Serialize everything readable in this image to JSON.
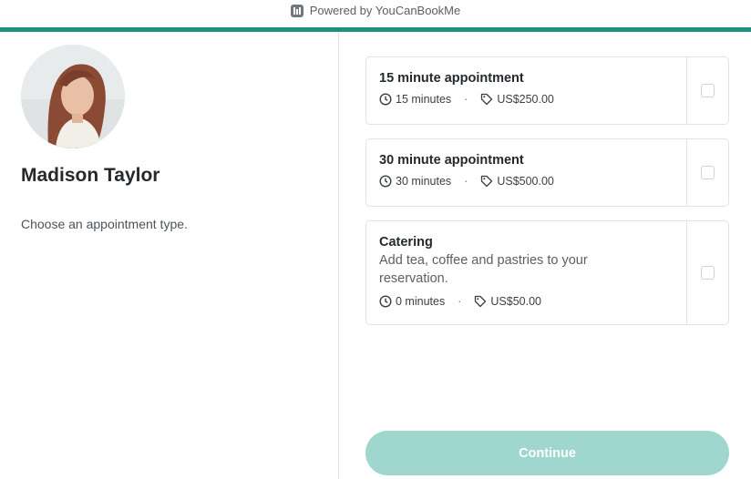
{
  "header": {
    "powered_by": "Powered by YouCanBookMe",
    "logo_icon": "calendar-logo-icon",
    "accent_color": "#1f8f7f"
  },
  "host": {
    "name": "Madison Taylor",
    "avatar_icon": "profile-photo",
    "instruction": "Choose an appointment type."
  },
  "appointments": [
    {
      "title": "15 minute appointment",
      "description": "",
      "duration": "15 minutes",
      "price": "US$250.00",
      "selected": false
    },
    {
      "title": "30 minute appointment",
      "description": "",
      "duration": "30 minutes",
      "price": "US$500.00",
      "selected": false
    },
    {
      "title": "Catering",
      "description": "Add tea, coffee and pastries to your reservation.",
      "duration": "0 minutes",
      "price": "US$50.00",
      "selected": false
    }
  ],
  "meta_separator": "·",
  "actions": {
    "continue_label": "Continue",
    "continue_color": "#9fd6cd"
  }
}
